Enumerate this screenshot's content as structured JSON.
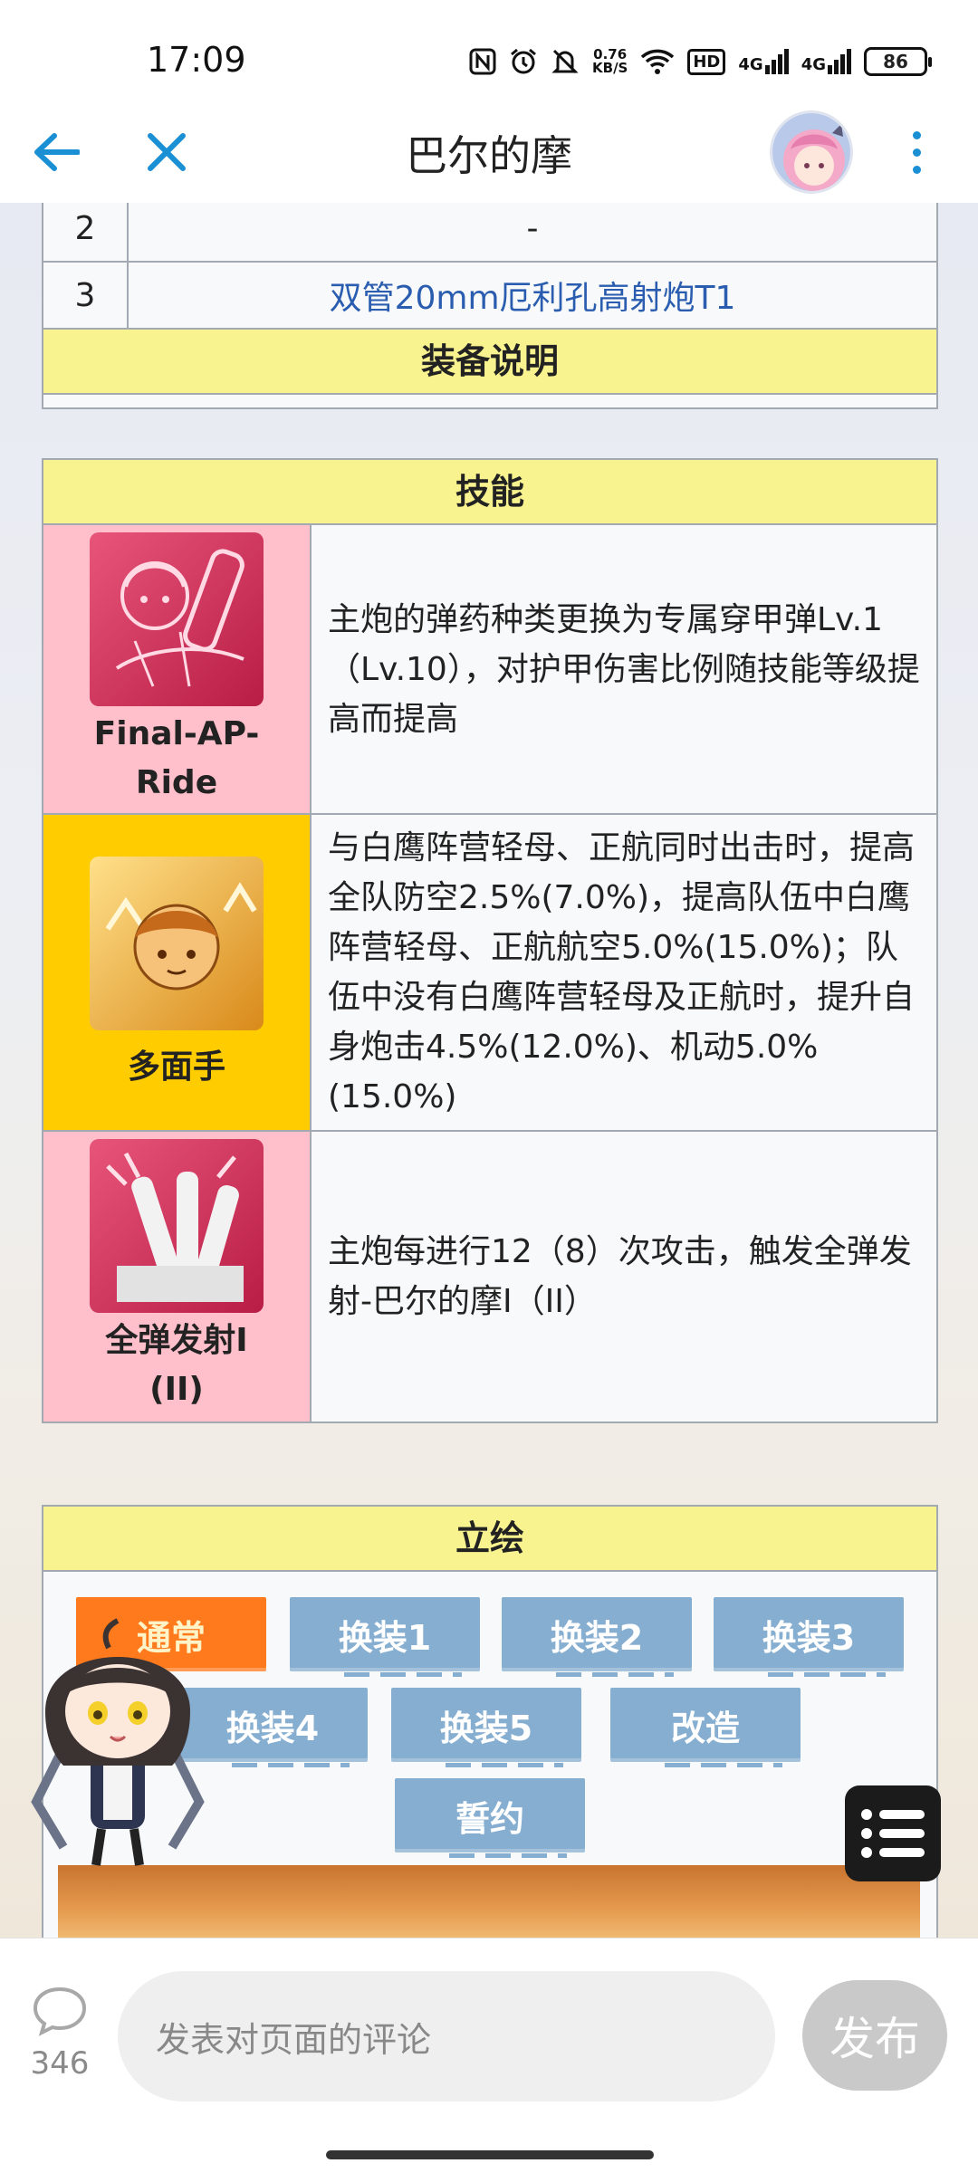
{
  "status_bar": {
    "time": "17:09",
    "net_speed_value": "0.76",
    "net_speed_unit": "KB/S",
    "hd_label": "HD",
    "sig1_label": "4G",
    "sig2_label": "4G",
    "battery": "86"
  },
  "header": {
    "title": "巴尔的摩",
    "accent_color": "#1a8fd4"
  },
  "equipment": {
    "rows": [
      {
        "num": "2",
        "name": "-"
      },
      {
        "num": "3",
        "name": "双管20mm厄利孔高射炮T1"
      }
    ],
    "description_header": "装备说明"
  },
  "skills": {
    "header": "技能",
    "items": [
      {
        "name": "Final-AP-Ride",
        "color": "#ffc0cb",
        "icon": "skill-shell-icon",
        "description": "主炮的弹药种类更换为专属穿甲弹Lv.1（Lv.10），对护甲伤害比例随技能等级提高而提高"
      },
      {
        "name": "多面手",
        "color": "#ffcc00",
        "icon": "skill-allrounder-icon",
        "description": "与白鹰阵营轻母、正航同时出击时，提高全队防空2.5%(7.0%)，提高队伍中白鹰阵营轻母、正航航空5.0%(15.0%)；队伍中没有白鹰阵营轻母及正航时，提升自身炮击4.5%(12.0%)、机动5.0%(15.0%)"
      },
      {
        "name": "全弹发射I (II)",
        "color": "#ffc0cb",
        "icon": "skill-barrage-icon",
        "description": "主炮每进行12（8）次攻击，触发全弹发射-巴尔的摩I（II）"
      }
    ]
  },
  "illustration": {
    "header": "立绘",
    "tabs": [
      "通常",
      "换装1",
      "换装2",
      "换装3",
      "换装4",
      "换装5",
      "改造",
      "誓约"
    ],
    "active_tab": "通常"
  },
  "bottom": {
    "comment_count": "346",
    "comment_placeholder": "发表对页面的评论",
    "publish_label": "发布"
  }
}
